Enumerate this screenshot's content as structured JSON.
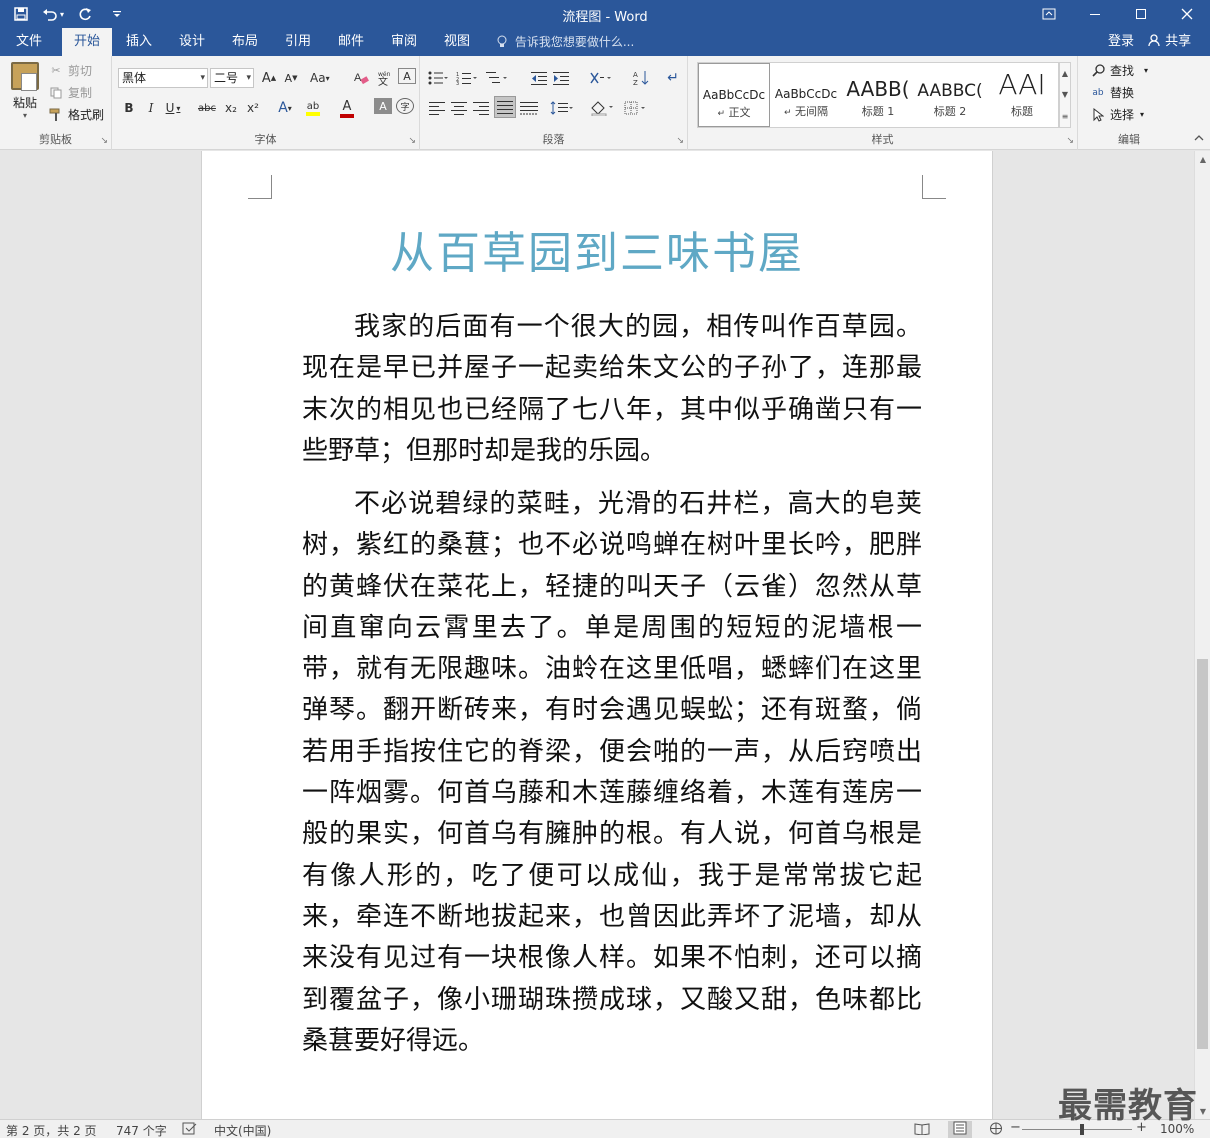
{
  "titlebar": {
    "document_title": "流程图 - Word",
    "qat": {
      "save_icon": "save-icon",
      "undo_icon": "undo-icon",
      "redo_icon": "redo-icon",
      "customize_icon": "customize-qat-icon"
    },
    "window_controls": {
      "ribbon_display_icon": "ribbon-display-options-icon",
      "minimize_icon": "minimize-icon",
      "maximize_icon": "maximize-icon",
      "close_icon": "close-icon"
    }
  },
  "tabs": [
    {
      "label": "文件"
    },
    {
      "label": "开始"
    },
    {
      "label": "插入"
    },
    {
      "label": "设计"
    },
    {
      "label": "布局"
    },
    {
      "label": "引用"
    },
    {
      "label": "邮件"
    },
    {
      "label": "审阅"
    },
    {
      "label": "视图"
    }
  ],
  "active_tab": "开始",
  "tell_me": {
    "placeholder": "告诉我您想要做什么..."
  },
  "account": {
    "login": "登录",
    "share": "共享"
  },
  "ribbon": {
    "clipboard": {
      "label": "剪贴板",
      "paste": "粘贴",
      "cut": "剪切",
      "copy": "复制",
      "format_painter": "格式刷"
    },
    "font": {
      "label": "字体",
      "font_name": "黑体",
      "font_size": "二号",
      "grow": "A",
      "shrink": "A",
      "change_case": "Aa",
      "bold": "B",
      "italic": "I",
      "underline": "U",
      "strikethrough": "abc",
      "subscript": "x₂",
      "superscript": "x²",
      "text_effects": "A",
      "font_color": "A",
      "char_shading": "A",
      "enclose": "字",
      "highlight_color": "#ffff00",
      "font_color_value": "#c00000"
    },
    "paragraph": {
      "label": "段落"
    },
    "styles": {
      "label": "样式",
      "items": [
        {
          "sample": "AaBbCcDc",
          "name": "正文"
        },
        {
          "sample": "AaBbCcDc",
          "name": "无间隔"
        },
        {
          "sample": "AABB(",
          "name": "标题 1"
        },
        {
          "sample": "AABBC(",
          "name": "标题 2"
        },
        {
          "sample": "AAI",
          "name": "标题"
        }
      ]
    },
    "editing": {
      "label": "编辑",
      "find": "查找",
      "replace": "替换",
      "select": "选择"
    }
  },
  "document": {
    "heading": "从百草园到三味书屋",
    "heading_color": "#5fa8c5",
    "paragraphs": [
      "我家的后面有一个很大的园，相传叫作百草园。现在是早已并屋子一起卖给朱文公的子孙了，连那最末次的相见也已经隔了七八年，其中似乎确凿只有一些野草；但那时却是我的乐园。",
      "不必说碧绿的菜畦，光滑的石井栏，高大的皂荚树，紫红的桑葚；也不必说鸣蝉在树叶里长吟，肥胖的黄蜂伏在菜花上，轻捷的叫天子（云雀）忽然从草间直窜向云霄里去了。单是周围的短短的泥墙根一带，就有无限趣味。油蛉在这里低唱，蟋蟀们在这里弹琴。翻开断砖来，有时会遇见蜈蚣；还有斑蝥，倘若用手指按住它的脊梁，便会啪的一声，从后窍喷出一阵烟雾。何首乌藤和木莲藤缠络着，木莲有莲房一般的果实，何首乌有臃肿的根。有人说，何首乌根是有像人形的，吃了便可以成仙，我于是常常拔它起来，牵连不断地拔起来，也曾因此弄坏了泥墙，却从来没有见过有一块根像人样。如果不怕刺，还可以摘到覆盆子，像小珊瑚珠攒成球，又酸又甜，色味都比桑葚要好得远。"
    ]
  },
  "status": {
    "page": "第 2 页，共 2 页",
    "words": "747 个字",
    "language": "中文(中国)",
    "zoom": "100%",
    "zoom_minus": "−",
    "zoom_plus": "+"
  },
  "watermark": "最需教育",
  "colors": {
    "accent": "#2b579a",
    "ribbon_bg": "#f3f3f3",
    "workspace_bg": "#e6e6e6"
  }
}
